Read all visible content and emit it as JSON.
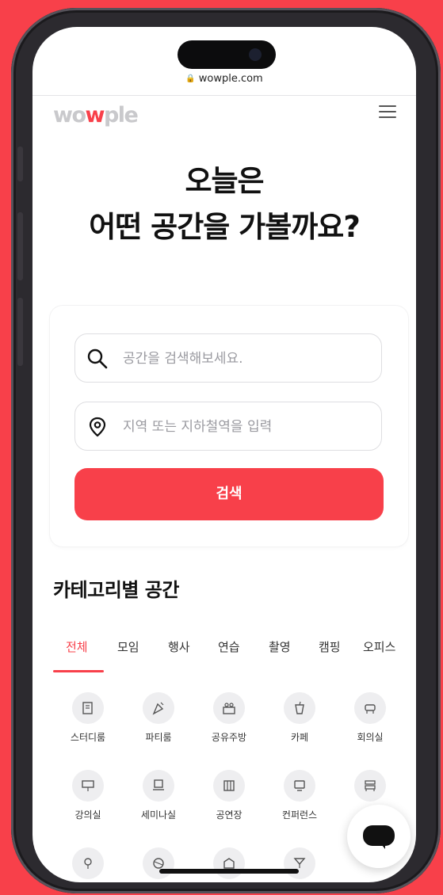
{
  "browser": {
    "url": "wowple.com"
  },
  "header": {
    "logo_prefix": "wo",
    "logo_dot": "w",
    "logo_suffix": "ple"
  },
  "hero": {
    "line1": "오늘은",
    "line2": "어떤 공간을 가볼까요?"
  },
  "search": {
    "keyword_placeholder": "공간을 검색해보세요.",
    "location_placeholder": "지역 또는 지하철역을 입력",
    "button_label": "검색"
  },
  "categories_section": {
    "title": "카테고리별 공간",
    "tabs": [
      "전체",
      "모임",
      "행사",
      "연습",
      "촬영",
      "캠핑",
      "오피스"
    ],
    "active_tab": "전체",
    "items": [
      {
        "label": "스터디룸",
        "icon": "study-room-icon"
      },
      {
        "label": "파티룸",
        "icon": "party-room-icon"
      },
      {
        "label": "공유주방",
        "icon": "shared-kitchen-icon"
      },
      {
        "label": "카페",
        "icon": "cafe-icon"
      },
      {
        "label": "회의실",
        "icon": "meeting-room-icon"
      },
      {
        "label": "강의실",
        "icon": "lecture-room-icon"
      },
      {
        "label": "세미나실",
        "icon": "seminar-room-icon"
      },
      {
        "label": "공연장",
        "icon": "performance-hall-icon"
      },
      {
        "label": "컨퍼런스",
        "icon": "conference-icon"
      },
      {
        "label": "",
        "icon": "rest-area-icon"
      }
    ]
  },
  "colors": {
    "accent": "#f8404a",
    "frame": "#2c2a2f"
  }
}
